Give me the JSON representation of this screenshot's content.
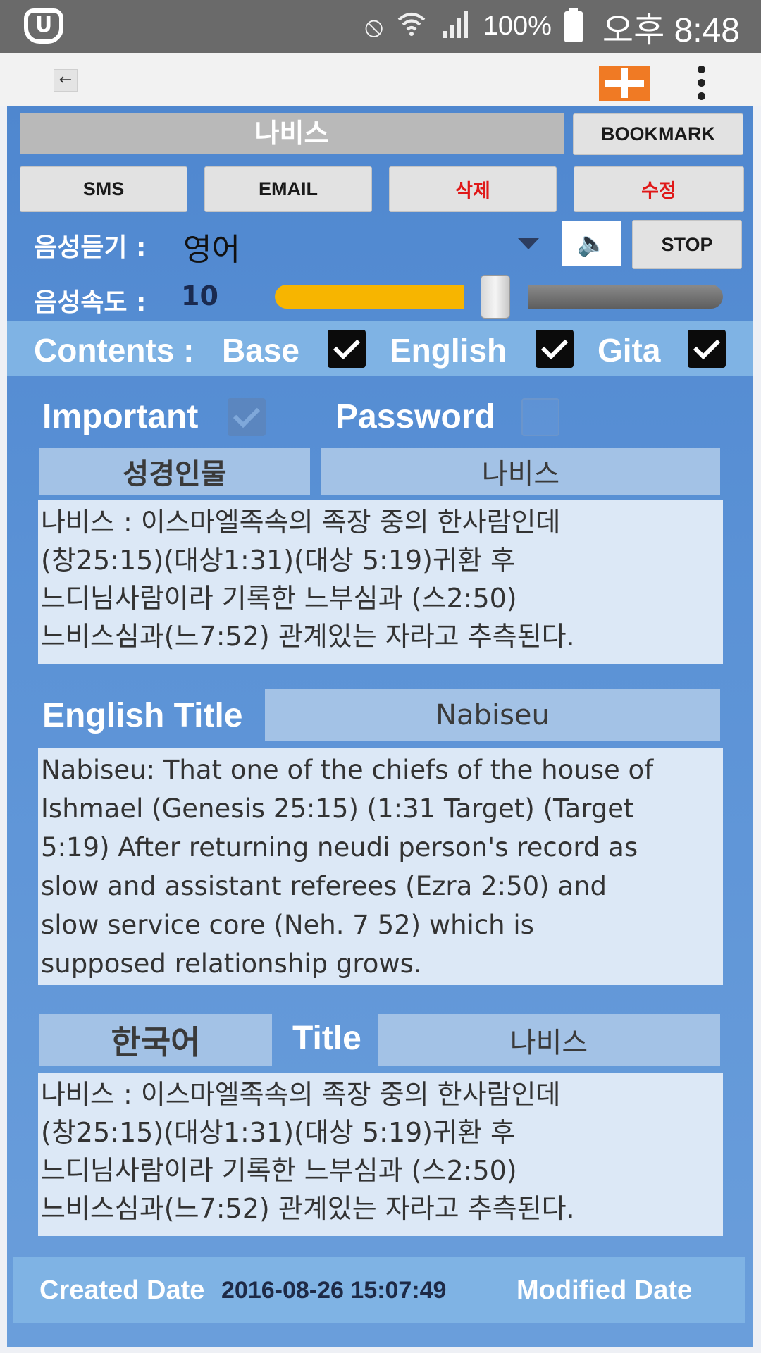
{
  "status_bar": {
    "battery_text": "100%",
    "time": "오후 8:48",
    "icons": [
      "carrier-logo-icon",
      "vibrate-mute-icon",
      "wifi-icon",
      "signal-icon",
      "battery-icon"
    ]
  },
  "action_bar": {
    "back_label": "←",
    "accent_color": "#f07a24"
  },
  "entry": {
    "title": "나비스",
    "bookmark_label": "BOOKMARK",
    "sms_label": "SMS",
    "email_label": "EMAIL",
    "delete_label": "삭제",
    "edit_label": "수정"
  },
  "voice": {
    "listen_label": "음성듣기 :",
    "language": "영어",
    "stop_label": "STOP",
    "speed_label": "음성속도 :",
    "speed_value": "10",
    "speed_fraction": 0.45
  },
  "contents": {
    "label": "Contents :",
    "options": [
      {
        "label": "Base",
        "checked": true
      },
      {
        "label": "English",
        "checked": true
      },
      {
        "label": "Gita",
        "checked": true
      }
    ]
  },
  "flags": {
    "important_label": "Important",
    "important_checked": true,
    "password_label": "Password",
    "password_checked": false
  },
  "category": {
    "label": "성경인물",
    "value": "나비스"
  },
  "base_text": "나비스 : 이스마엘족속의 족장 중의 한사람인데\n(창25:15)(대상1:31)(대상 5:19)귀환 후\n느디님사람이라 기록한 느부심과 (스2:50)\n느비스심과(느7:52) 관계있는 자라고 추측된다.",
  "english": {
    "title_label": "English Title",
    "title_value": "Nabiseu",
    "text": "Nabiseu: That one of the chiefs of the house of\nIshmael (Genesis 25:15) (1:31 Target) (Target\n5:19) After returning neudi person's record as\nslow and assistant referees (Ezra 2:50) and\nslow service core (Neh. 7 52) which is\nsupposed relationship grows."
  },
  "korean": {
    "lang_label": "한국어",
    "title_label": "Title",
    "title_value": "나비스",
    "text": "나비스 : 이스마엘족속의 족장 중의 한사람인데\n(창25:15)(대상1:31)(대상 5:19)귀환 후\n느디님사람이라 기록한 느부심과 (스2:50)\n느비스심과(느7:52) 관계있는 자라고 추측된다."
  },
  "footer": {
    "created_label": "Created Date",
    "created_value": "2016-08-26 15:07:49",
    "modified_label": "Modified Date"
  }
}
